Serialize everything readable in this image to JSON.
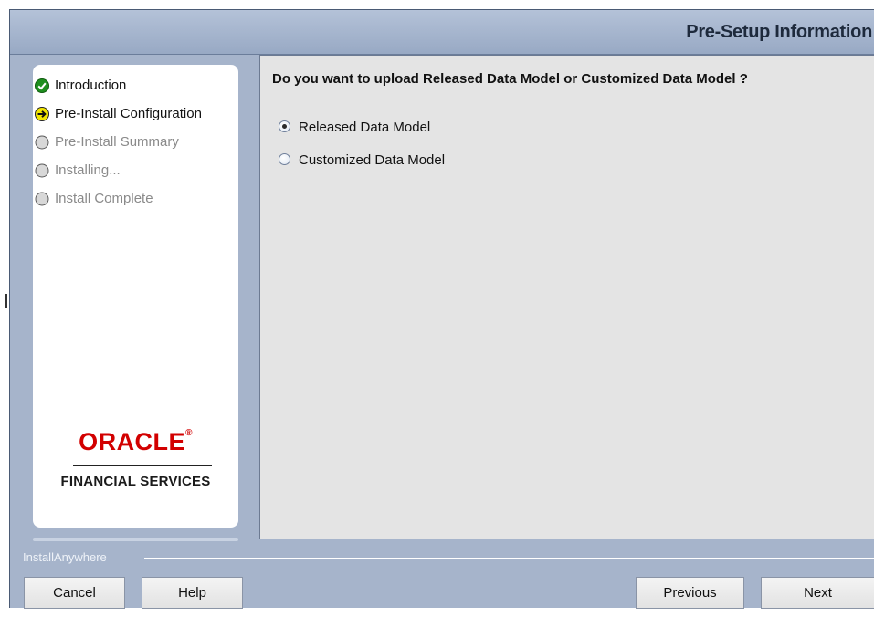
{
  "header": {
    "title": "Pre-Setup Information"
  },
  "steps": [
    {
      "label": "Introduction",
      "status": "done",
      "icon": "check-circle-icon"
    },
    {
      "label": "Pre-Install Configuration",
      "status": "current",
      "icon": "arrow-right-circle-icon"
    },
    {
      "label": "Pre-Install Summary",
      "status": "pending",
      "icon": "empty-circle-icon"
    },
    {
      "label": "Installing...",
      "status": "pending",
      "icon": "empty-circle-icon"
    },
    {
      "label": "Install Complete",
      "status": "pending",
      "icon": "empty-circle-icon"
    }
  ],
  "logo": {
    "brand": "ORACLE",
    "tm": "®",
    "subtitle": "FINANCIAL SERVICES"
  },
  "main": {
    "question": "Do you want to upload Released Data Model or Customized Data Model ?",
    "options": [
      {
        "label": "Released Data Model",
        "selected": true
      },
      {
        "label": "Customized Data Model",
        "selected": false
      }
    ]
  },
  "footer": {
    "brand": "InstallAnywhere",
    "cancel": "Cancel",
    "help": "Help",
    "previous": "Previous",
    "next": "Next"
  },
  "colors": {
    "window_bg": "#a6b4cb",
    "oracle_red": "#d20000",
    "step_done": "#1a9a1a",
    "step_current": "#e8d800"
  }
}
